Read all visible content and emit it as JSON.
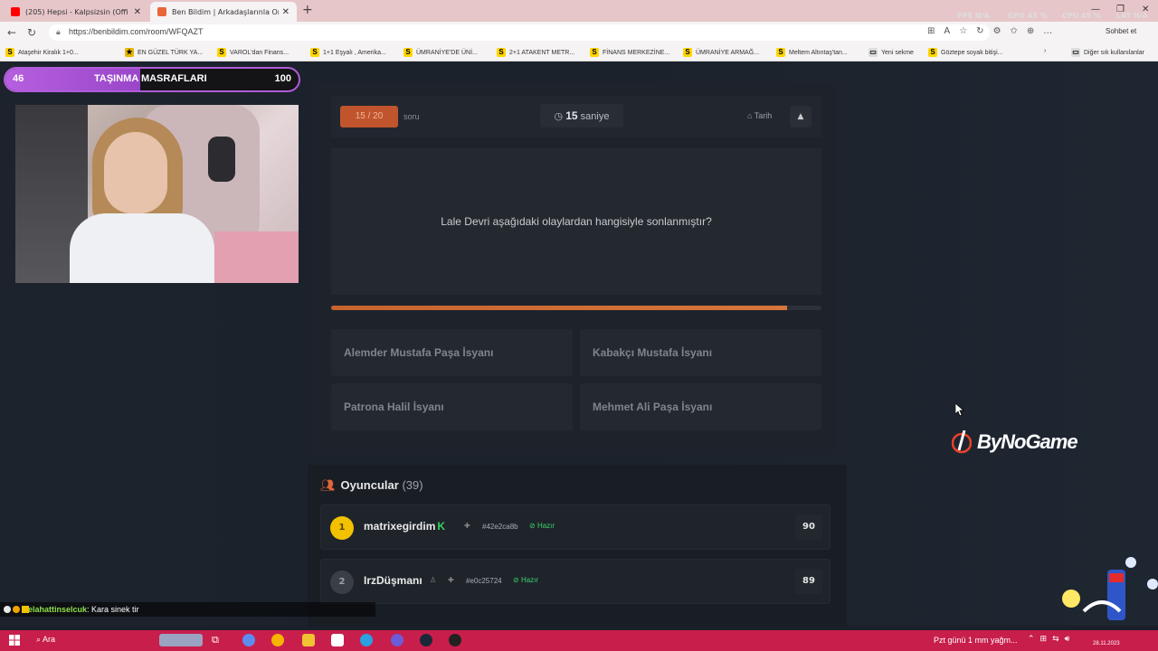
{
  "browser": {
    "tabs": [
      {
        "title": "(205) Hepsi - Kalpsizsin (Offi",
        "favicon_color": "#ff0000",
        "active": false
      },
      {
        "title": "Ben Bildim | Arkadaşlarınla Online",
        "favicon_color": "#e8663a",
        "active": true
      }
    ],
    "new_tab": "+",
    "perf": {
      "fps": "FPS N/A",
      "gpu": "GPU 43 %",
      "cpu": "CPU 45 %",
      "lat": "LAT N/A"
    },
    "url": "https://benbildim.com/room/WFQAZT",
    "sohbet": "Sohbet et",
    "bookmarks": [
      {
        "label": "Ataşehir Kiralık 1+0...",
        "s": true
      },
      {
        "label": "EN GÜZEL TÜRK YA...",
        "s": false
      },
      {
        "label": "VAROL'dan Finans...",
        "s": true
      },
      {
        "label": "1+1 Eşyalı , Amerika...",
        "s": true
      },
      {
        "label": "ÜMRANİYE'DE ÜNİ...",
        "s": true
      },
      {
        "label": "2+1 ATAKENT METR...",
        "s": true
      },
      {
        "label": "FİNANS MERKEZİNE...",
        "s": true
      },
      {
        "label": "ÜMRANİYE ARMAĞ...",
        "s": true
      },
      {
        "label": "Meltem Altıntaş'tan...",
        "s": true
      },
      {
        "label": "Yeni sekme",
        "s": false
      },
      {
        "label": "Göztepe soyak bitişi...",
        "s": true
      }
    ],
    "other_bookmarks": "Diğer sık kullanılanlar"
  },
  "overlay": {
    "left": "46",
    "title": "TAŞINMA MASRAFLARI",
    "right": "100",
    "fill_fraction": 0.46
  },
  "quiz": {
    "counter": "15 / 20",
    "counter_suffix": "soru",
    "timer_value": "15",
    "timer_unit": "saniye",
    "category": "Tarih",
    "question": "Lale Devri aşağıdaki olaylardan hangisiyle sonlanmıştır?",
    "progress_fraction": 0.93,
    "answers": [
      "Alemder Mustafa Paşa İsyanı",
      "Kabakçı Mustafa İsyanı",
      "Patrona Halil İsyanı",
      "Mehmet Ali Paşa İsyanı"
    ]
  },
  "players": {
    "title": "Oyuncular",
    "count": "(39)",
    "list": [
      {
        "rank": "1",
        "name": "matrixegirdim",
        "id": "#42e2ca8b",
        "status": "Hazır",
        "score": "90",
        "rank_color": "#f2c200"
      },
      {
        "rank": "2",
        "name": "IrzDüşmanı",
        "id": "#e0c25724",
        "status": "Hazır",
        "score": "89",
        "rank_color": "#9aa0a6"
      }
    ]
  },
  "brand": "ByNoGame",
  "chat": {
    "user": "selahattinselcuk",
    "message": ": Kara sinek tir"
  },
  "taskbar": {
    "search": "Ara",
    "weather": "Pzt günü 1 mm yağm...",
    "date": "28.11.2023",
    "accent": "#c81e4c"
  }
}
